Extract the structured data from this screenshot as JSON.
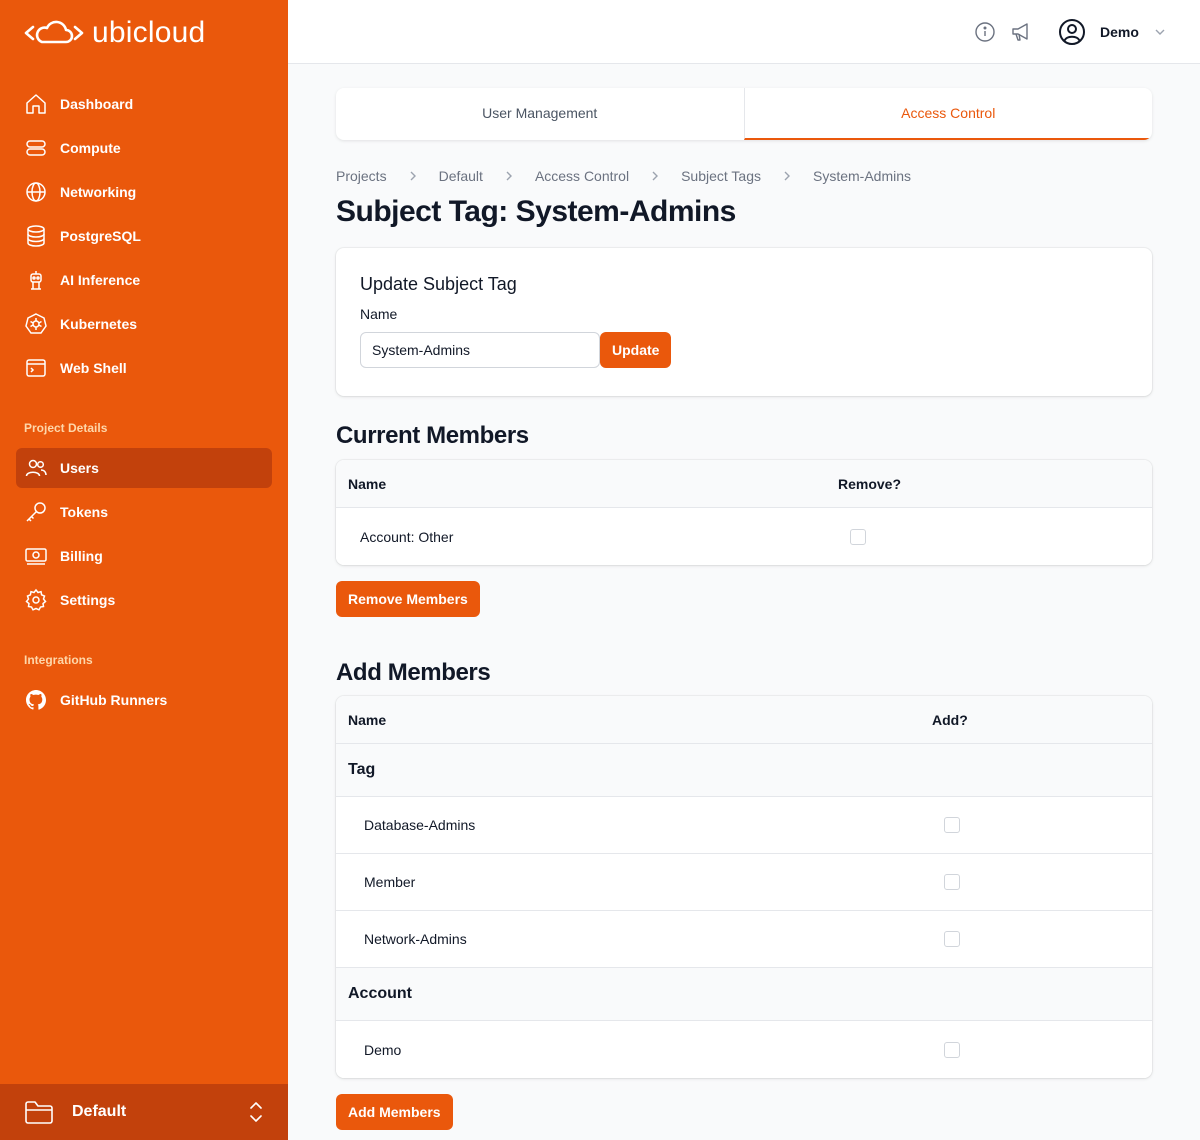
{
  "brand": {
    "name": "ubicloud"
  },
  "sidebar": {
    "items": [
      {
        "label": "Dashboard",
        "icon": "home-icon"
      },
      {
        "label": "Compute",
        "icon": "server-icon"
      },
      {
        "label": "Networking",
        "icon": "globe-icon"
      },
      {
        "label": "PostgreSQL",
        "icon": "database-icon"
      },
      {
        "label": "AI Inference",
        "icon": "robot-icon"
      },
      {
        "label": "Kubernetes",
        "icon": "kubernetes-icon"
      },
      {
        "label": "Web Shell",
        "icon": "terminal-icon"
      }
    ],
    "project_section": "Project Details",
    "project_items": [
      {
        "label": "Users",
        "icon": "users-icon",
        "active": true
      },
      {
        "label": "Tokens",
        "icon": "key-icon"
      },
      {
        "label": "Billing",
        "icon": "banknote-icon"
      },
      {
        "label": "Settings",
        "icon": "gear-icon"
      }
    ],
    "integrations_section": "Integrations",
    "integration_items": [
      {
        "label": "GitHub Runners",
        "icon": "github-icon"
      }
    ],
    "project_switcher": {
      "name": "Default"
    }
  },
  "header": {
    "user_name": "Demo"
  },
  "tabs": [
    {
      "label": "User Management",
      "active": false
    },
    {
      "label": "Access Control",
      "active": true
    }
  ],
  "breadcrumb": [
    "Projects",
    "Default",
    "Access Control",
    "Subject Tags",
    "System-Admins"
  ],
  "page_title": "Subject Tag: System-Admins",
  "update_form": {
    "title": "Update Subject Tag",
    "name_label": "Name",
    "name_value": "System-Admins",
    "submit_label": "Update"
  },
  "current_members": {
    "title": "Current Members",
    "columns": [
      "Name",
      "Remove?"
    ],
    "rows": [
      {
        "name": "Account: Other",
        "checked": false
      }
    ],
    "button_label": "Remove Members"
  },
  "add_members": {
    "title": "Add Members",
    "columns": [
      "Name",
      "Add?"
    ],
    "groups": [
      {
        "label": "Tag",
        "rows": [
          "Database-Admins",
          "Member",
          "Network-Admins"
        ]
      },
      {
        "label": "Account",
        "rows": [
          "Demo"
        ]
      }
    ],
    "button_label": "Add Members"
  },
  "colors": {
    "accent": "#ea580c",
    "accent_dark": "#c2410c"
  }
}
